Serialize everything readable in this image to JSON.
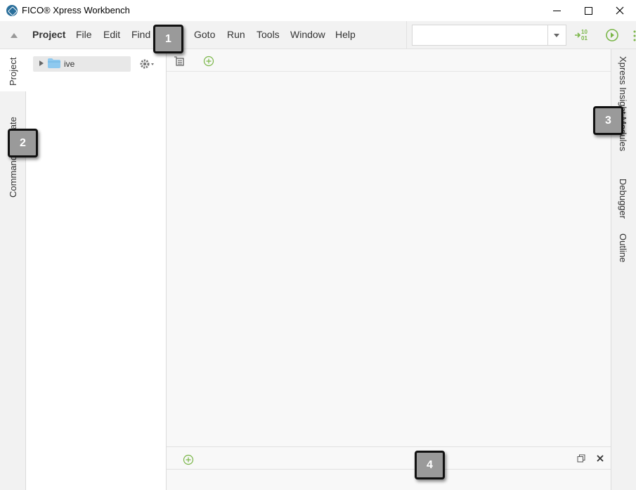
{
  "window": {
    "title": "FICO® Xpress Workbench"
  },
  "menubar": {
    "items": [
      {
        "label": "Project",
        "active": true
      },
      {
        "label": "File"
      },
      {
        "label": "Edit"
      },
      {
        "label": "Find"
      },
      {
        "label": "Goto"
      },
      {
        "label": "Run"
      },
      {
        "label": "Tools"
      },
      {
        "label": "Window"
      },
      {
        "label": "Help"
      }
    ],
    "run_config_value": "",
    "toolbar_icons": [
      "compile-icon",
      "run-icon"
    ],
    "accent_color": "#7ab648"
  },
  "left_rail": {
    "tabs": [
      {
        "label": "Project",
        "active": true
      },
      {
        "label": "Command Navigate"
      }
    ]
  },
  "project_panel": {
    "tree": [
      {
        "label": "ive",
        "icon": "folder-icon",
        "expanded": false
      }
    ],
    "settings_icon": "gear-icon"
  },
  "editor": {
    "toolbar_icons": [
      "list-icon",
      "add-tab-icon"
    ]
  },
  "right_rail": {
    "tabs": [
      {
        "label": "Xpress Insight Modules"
      },
      {
        "label": "Debugger"
      },
      {
        "label": "Outline"
      }
    ]
  },
  "bottom_panel": {
    "icons": [
      "add-tab-icon",
      "restore-icon",
      "close-icon"
    ]
  },
  "callouts": [
    "1",
    "2",
    "3",
    "4"
  ]
}
